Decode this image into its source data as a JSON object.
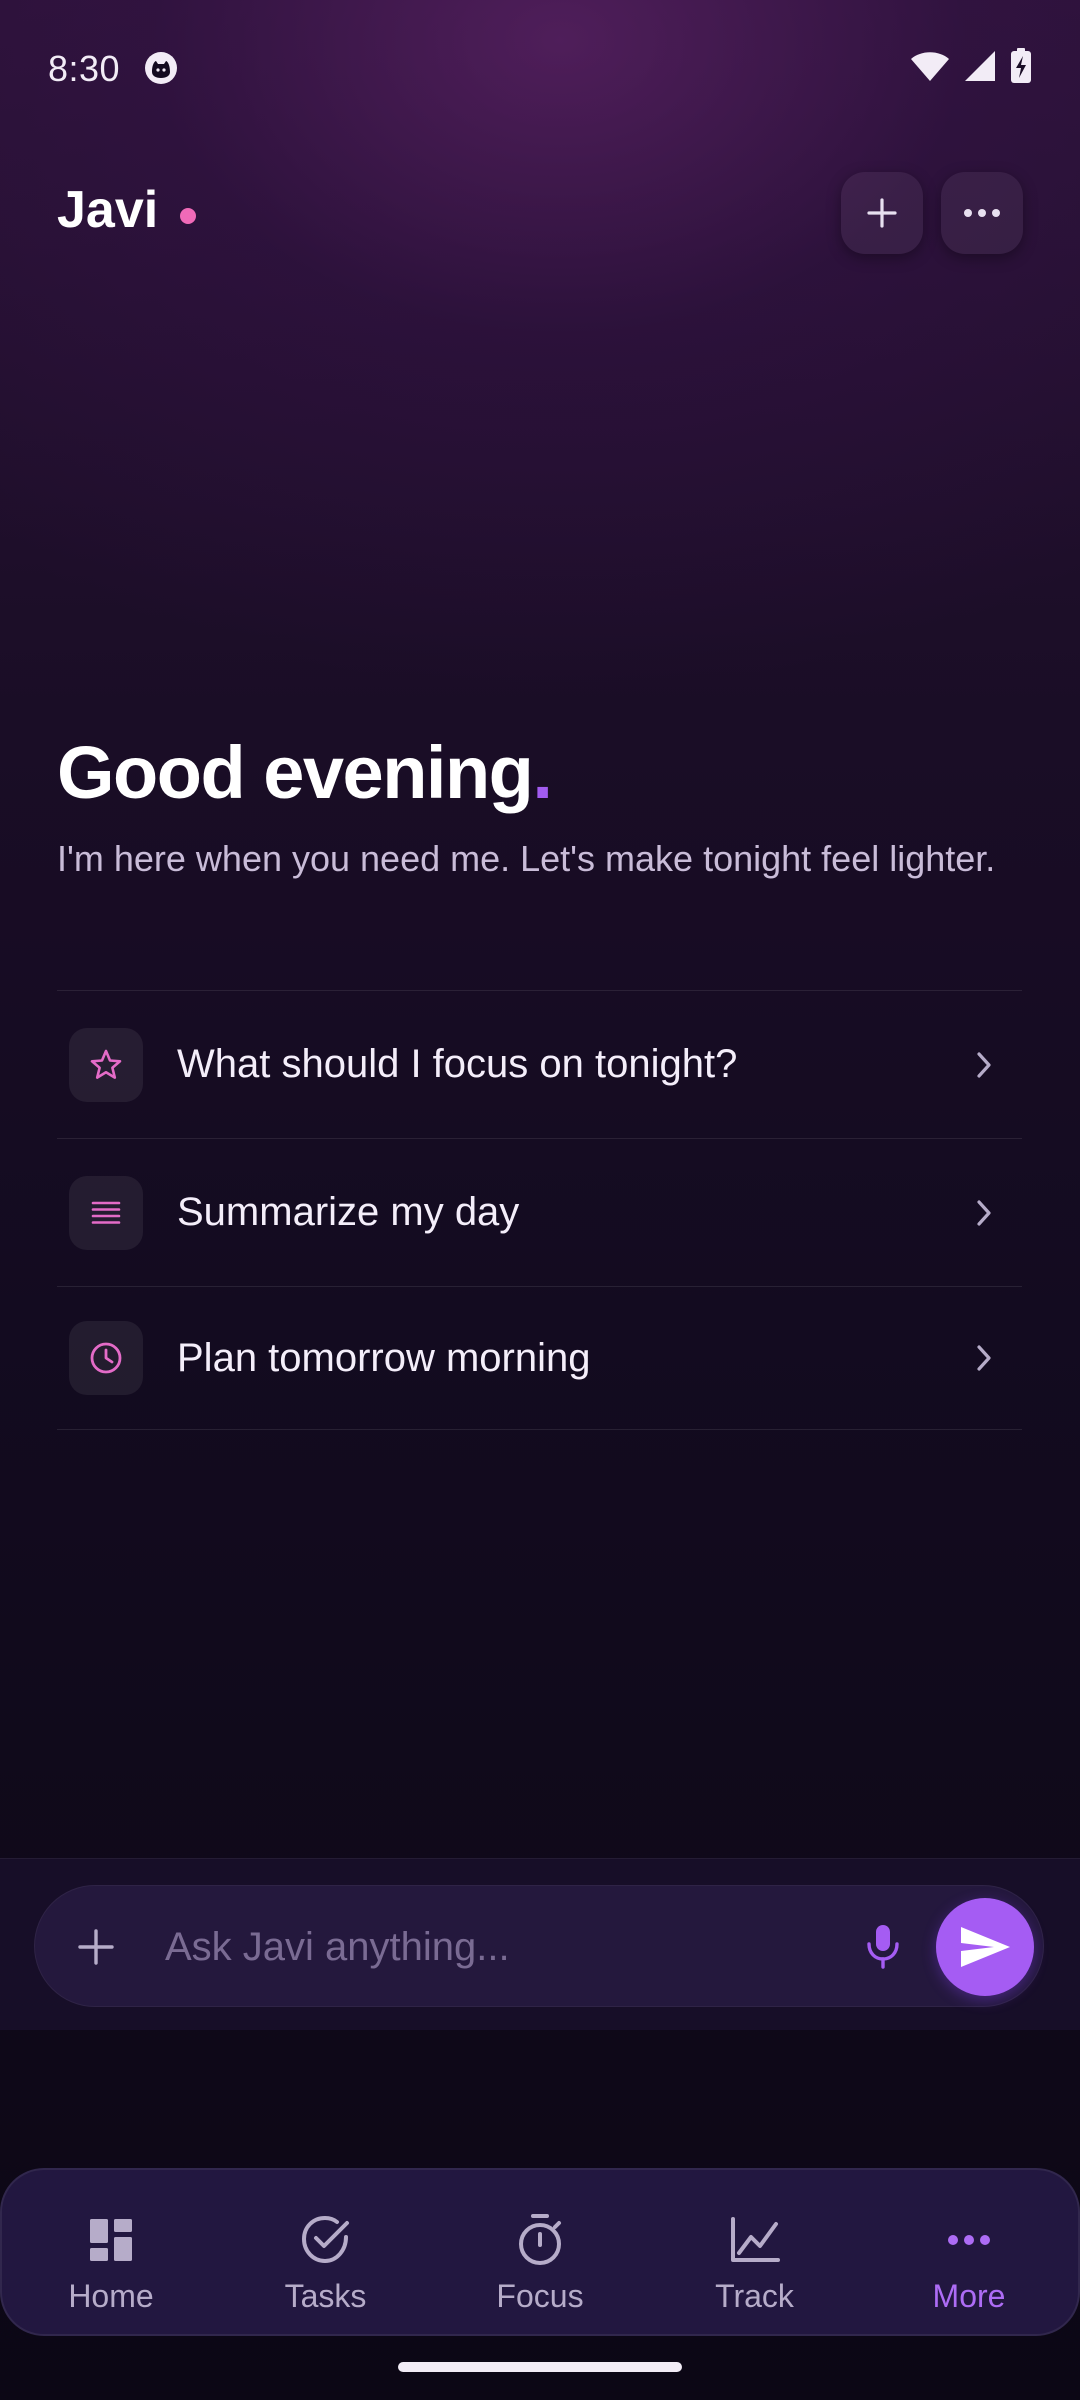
{
  "status_bar": {
    "time": "8:30"
  },
  "header": {
    "app_name": "Javi"
  },
  "greeting": {
    "title": "Good evening",
    "punctuation": ".",
    "subtitle": "I'm here when you need me. Let's make tonight feel lighter."
  },
  "suggestions": [
    {
      "label": "What should I focus on tonight?",
      "icon": "star-icon"
    },
    {
      "label": "Summarize my day",
      "icon": "lines-icon"
    },
    {
      "label": "Plan tomorrow morning",
      "icon": "clock-icon"
    }
  ],
  "composer": {
    "placeholder": "Ask Javi anything...",
    "value": ""
  },
  "nav": {
    "items": [
      {
        "label": "Home",
        "icon": "dashboard-icon",
        "active": false
      },
      {
        "label": "Tasks",
        "icon": "check-circle-icon",
        "active": false
      },
      {
        "label": "Focus",
        "icon": "timer-icon",
        "active": false
      },
      {
        "label": "Track",
        "icon": "chart-line-icon",
        "active": false
      },
      {
        "label": "More",
        "icon": "more-horizontal-icon",
        "active": true
      }
    ]
  },
  "colors": {
    "accent": "#a55cf3",
    "dot": "#f06ab8",
    "icon_pink": "#e46bc8"
  }
}
